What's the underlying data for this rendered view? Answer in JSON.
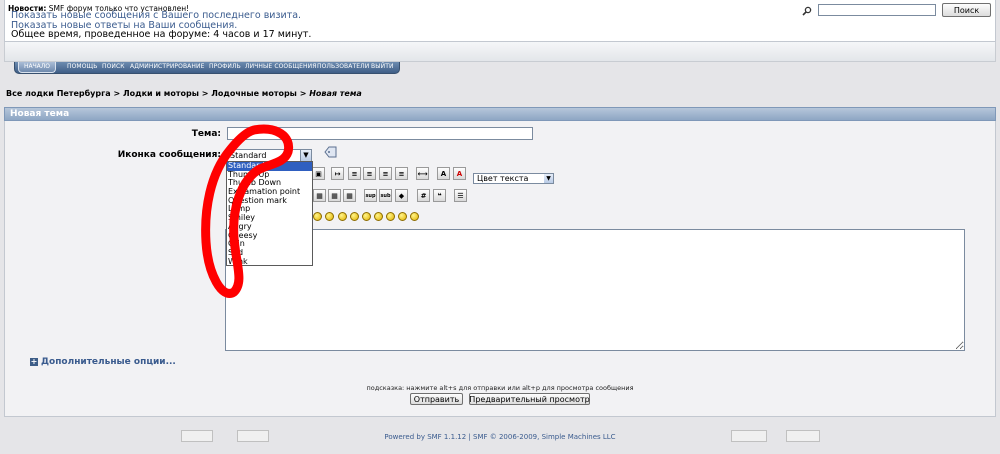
{
  "topbox": {
    "new_posts_link": "Показать новые сообщения с Вашего последнего визита.",
    "new_replies_link": "Показать новые ответы на Ваши сообщения.",
    "time_spent": "Общее время, проведенное на форуме: 4 часов и 17 минут."
  },
  "news": {
    "label": "Новости:",
    "text": "SMF форум только что установлен!"
  },
  "search": {
    "value": "",
    "button": "Поиск"
  },
  "menu": {
    "items": [
      "НАЧАЛО",
      "ПОМОЩЬ",
      "ПОИСК",
      "АДМИНИСТРИРОВАНИЕ",
      "ПРОФИЛЬ",
      "ЛИЧНЫЕ СООБЩЕНИЯ",
      "ПОЛЬЗОВАТЕЛИ",
      "ВЫЙТИ"
    ]
  },
  "breadcrumb": {
    "items": [
      "Все лодки Петербурга",
      "Лодки и моторы",
      "Лодочные моторы"
    ],
    "separator": " > ",
    "current": "Новая тема"
  },
  "panel": {
    "title": "Новая тема"
  },
  "form": {
    "subject_label": "Тема:",
    "subject_value": "",
    "icon_label": "Иконка сообщения:",
    "icon_selected": "Standard",
    "icon_options": [
      "Standard",
      "Thumb Up",
      "Thumb Down",
      "Exclamation point",
      "Question mark",
      "Lamp",
      "Smiley",
      "Angry",
      "Cheesy",
      "Grin",
      "Sad",
      "Wink"
    ],
    "color_select": "Цвет текста",
    "more_options": "Дополнительные опции...",
    "hint": "подсказка: нажмите alt+s для отправки или alt+p для просмотра сообщения",
    "submit": "Отправить",
    "preview": "Предварительный просмотр"
  },
  "toolbar": {
    "row1": [
      "b1",
      "b2",
      "b3",
      "b4",
      "b5",
      "b6",
      "b7",
      "b8",
      "b9",
      "b10"
    ],
    "row2_sup": "sup",
    "row2_sub": "sub",
    "row2_hash": "#"
  },
  "footer": {
    "text": "Powered by SMF 1.1.12 | SMF © 2006-2009, Simple Machines LLC"
  },
  "colors": {
    "menu": "#4a6a93",
    "link": "#3a5b8e",
    "selected_option": "#2f5fc0",
    "annotation": "#ff0000"
  }
}
